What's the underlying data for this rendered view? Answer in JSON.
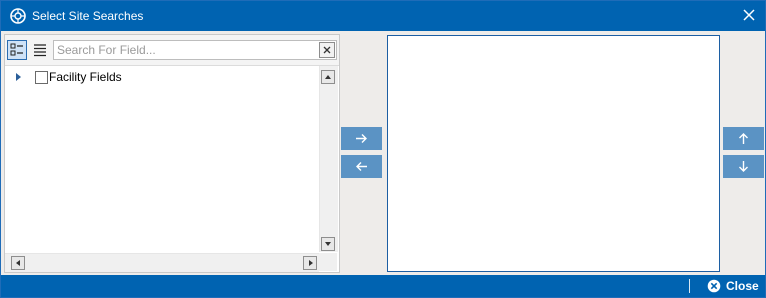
{
  "window": {
    "title": "Select Site Searches",
    "accent_color": "#0063b1",
    "icons": {
      "app": "app-logo-icon",
      "close": "close-icon"
    }
  },
  "field_picker": {
    "view_buttons": [
      "tree-view-icon",
      "list-view-icon"
    ],
    "search": {
      "placeholder": "Search For Field...",
      "value": ""
    },
    "tree": [
      {
        "label": "Facility Fields",
        "checked": false,
        "expanded": false
      }
    ]
  },
  "transfer_buttons": [
    "arrow-right-icon",
    "arrow-left-icon"
  ],
  "order_buttons": [
    "arrow-up-icon",
    "arrow-down-icon"
  ],
  "selected_fields": [],
  "footer": {
    "close_label": "Close"
  }
}
